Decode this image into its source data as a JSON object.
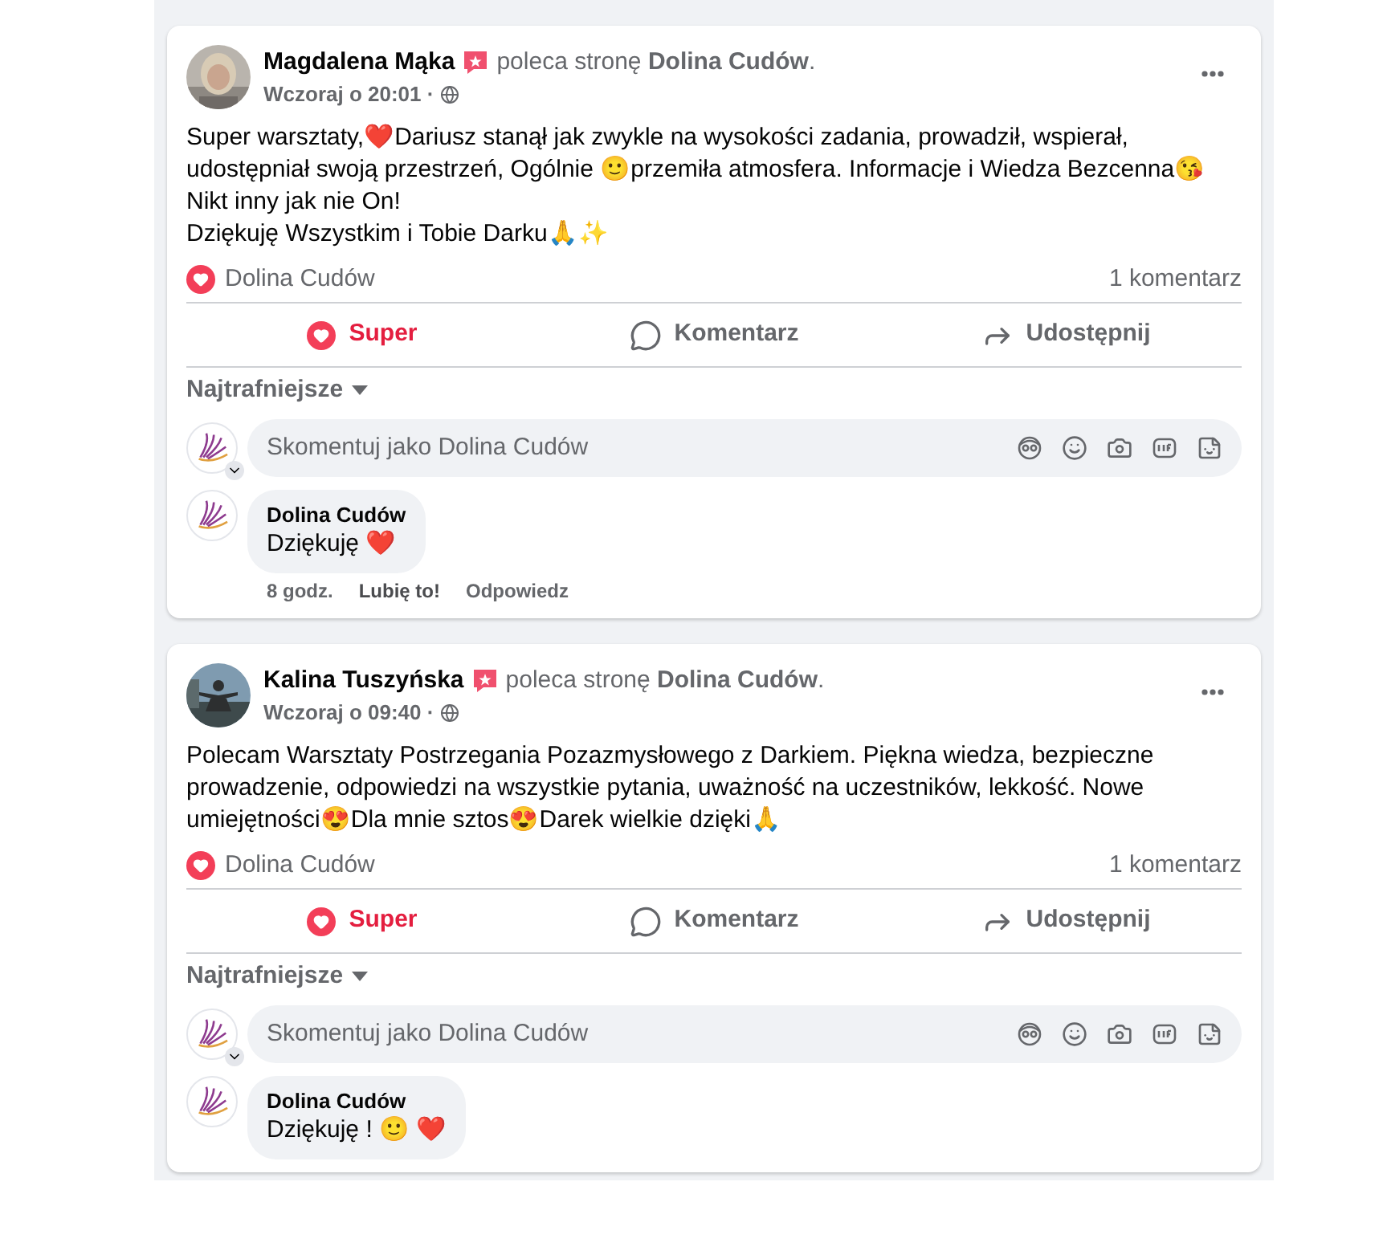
{
  "posts": [
    {
      "author": "Magdalena Mąka",
      "recommends": "poleca stronę **Dolina Cudów**.",
      "time": "Wczoraj o 20:01 ·",
      "text": "Super warsztaty,❤️Dariusz stanął jak zwykle na wysokości zadania, prowadził, wspierał, udostępniał swoją przestrzeń, Ogólnie 🙂przemiła atmosfera. Informacje i Wiedza Bezcenna😘\nNikt inny jak nie On!\nDziękuję Wszystkim i Tobie Darku🙏✨",
      "reaction_by": "Dolina Cudów",
      "comment_count": "1 komentarz",
      "actions": [
        {
          "kind": "react",
          "label": "Super",
          "selected": true
        },
        {
          "kind": "comment",
          "label": "Komentarz",
          "selected": false
        },
        {
          "kind": "share",
          "label": "Udostępnij",
          "selected": false
        }
      ],
      "sort": "Najtrafniejsze",
      "composer": {
        "placeholder": "Skomentuj jako Dolina Cudów"
      },
      "comments": [
        {
          "author": "Dolina Cudów",
          "text": "Dziękuję ❤️",
          "meta": [
            "8 godz.",
            "Lubię to!",
            "Odpowiedz"
          ]
        }
      ]
    },
    {
      "author": "Kalina Tuszyńska",
      "recommends": "poleca stronę **Dolina Cudów**.",
      "time": "Wczoraj o 09:40 ·",
      "text": "Polecam Warsztaty Postrzegania Pozazmysłowego z Darkiem. Piękna wiedza, bezpieczne prowadzenie,  odpowiedzi na wszystkie pytania, uważność na uczestników, lekkość. Nowe umiejętności😍Dla mnie sztos😍Darek wielkie dzięki🙏",
      "reaction_by": "Dolina Cudów",
      "comment_count": "1 komentarz",
      "actions": [
        {
          "kind": "react",
          "label": "Super",
          "selected": true
        },
        {
          "kind": "comment",
          "label": "Komentarz",
          "selected": false
        },
        {
          "kind": "share",
          "label": "Udostępnij",
          "selected": false
        }
      ],
      "sort": "Najtrafniejsze",
      "composer": {
        "placeholder": "Skomentuj jako Dolina Cudów"
      },
      "comments": [
        {
          "author": "Dolina Cudów",
          "text": "Dziękuję ! 🙂 ❤️"
        }
      ]
    }
  ]
}
